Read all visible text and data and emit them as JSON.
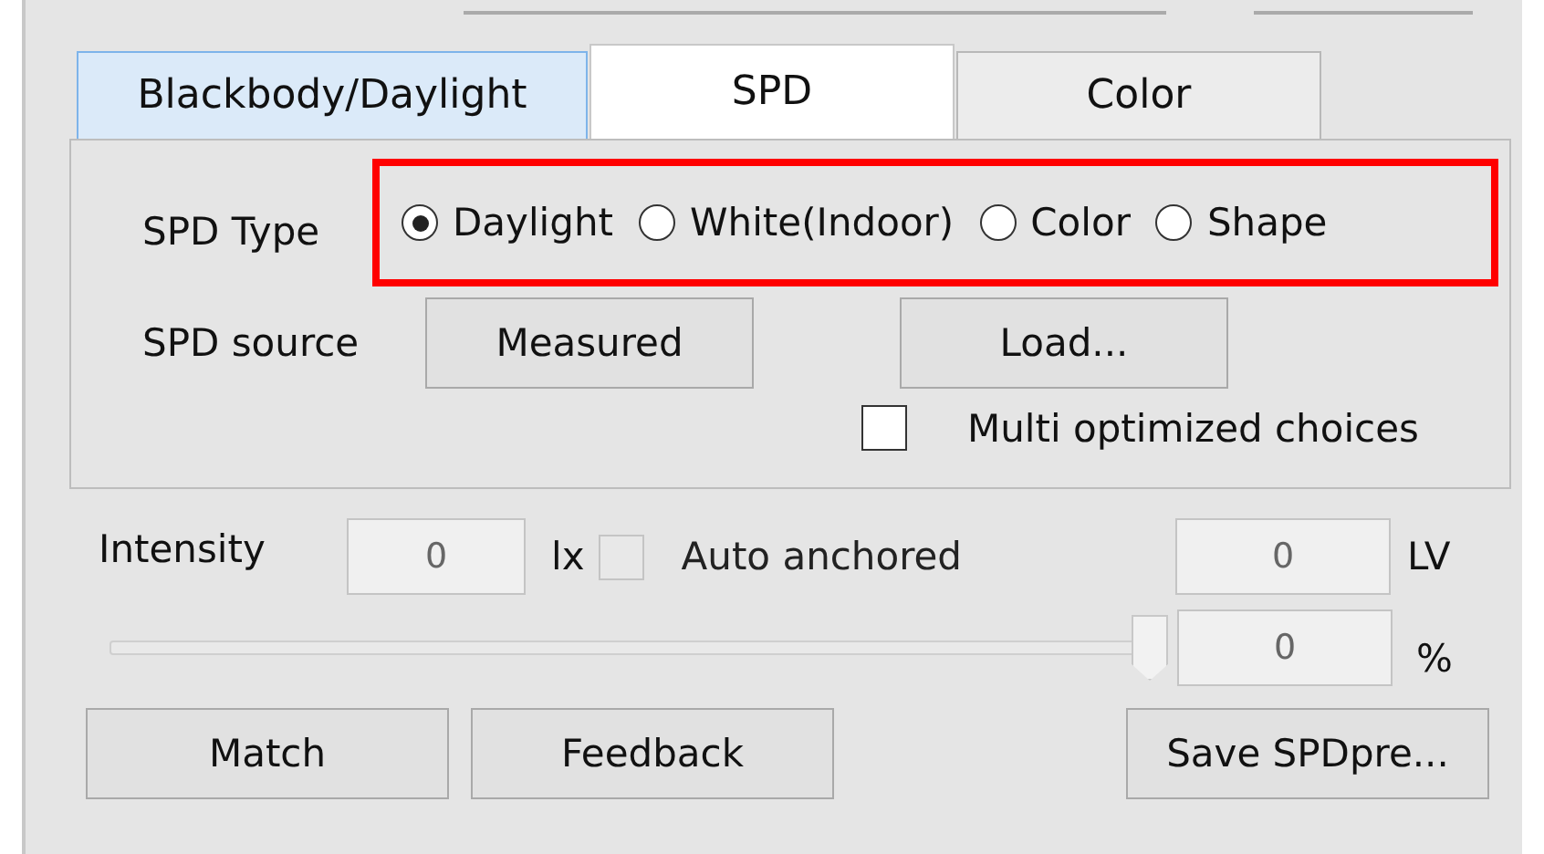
{
  "tabs": [
    {
      "label": "Blackbody/Daylight",
      "selected": false,
      "hover": true
    },
    {
      "label": "SPD",
      "selected": true,
      "hover": false
    },
    {
      "label": "Color",
      "selected": false,
      "hover": false
    }
  ],
  "spd_type": {
    "label": "SPD Type",
    "highlighted": true,
    "options": [
      {
        "label": "Daylight",
        "selected": true
      },
      {
        "label": "White(Indoor)",
        "selected": false
      },
      {
        "label": "Color",
        "selected": false
      },
      {
        "label": "Shape",
        "selected": false
      }
    ]
  },
  "spd_source": {
    "label": "SPD source",
    "buttons": [
      "Measured",
      "Load..."
    ]
  },
  "multi_optimized": {
    "label": "Multi optimized choices",
    "checked": false
  },
  "intensity": {
    "label": "Intensity",
    "value": "0",
    "unit": "lx",
    "auto_anchored": {
      "label": "Auto anchored",
      "checked": false,
      "disabled": true
    },
    "lv_value": "0",
    "lv_unit": "LV"
  },
  "slider": {
    "level": 1,
    "value": "0",
    "unit": "%"
  },
  "buttons": [
    "Match",
    "Feedback",
    "Save SPDpre..."
  ]
}
